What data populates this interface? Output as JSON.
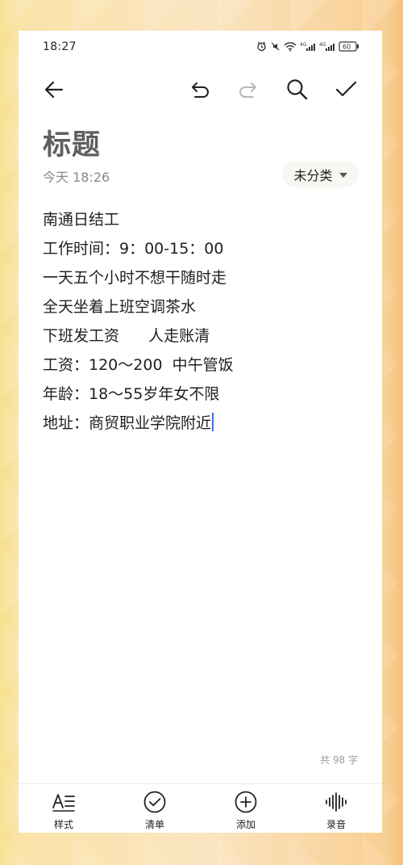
{
  "status_bar": {
    "time": "18:27",
    "network_1": "4G",
    "network_2": "4G",
    "battery": "60"
  },
  "toolbar": {
    "back_icon": "back-arrow-icon",
    "undo_icon": "undo-icon",
    "redo_icon": "redo-icon",
    "search_icon": "search-icon",
    "done_icon": "check-icon"
  },
  "note": {
    "title": "标题",
    "meta": "今天 18:26",
    "category": "未分类",
    "lines": [
      "南通日结工",
      "工作时间：9：00-15：00",
      "一天五个小时不想干随时走",
      "全天坐着上班空调茶水",
      "下班发工资      人走账清",
      "工资：120～200  中午管饭",
      "年龄：18～55岁年女不限",
      "地址：商贸职业学院附近"
    ],
    "word_count": "共 98 字"
  },
  "bottom_bar": {
    "style": "样式",
    "checklist": "清单",
    "add": "添加",
    "record": "录音"
  },
  "colors": {
    "title": "#5f5f5f",
    "body_text": "#1f1f1f",
    "caret": "#3b6cf1",
    "meta": "#8a8a8a"
  }
}
